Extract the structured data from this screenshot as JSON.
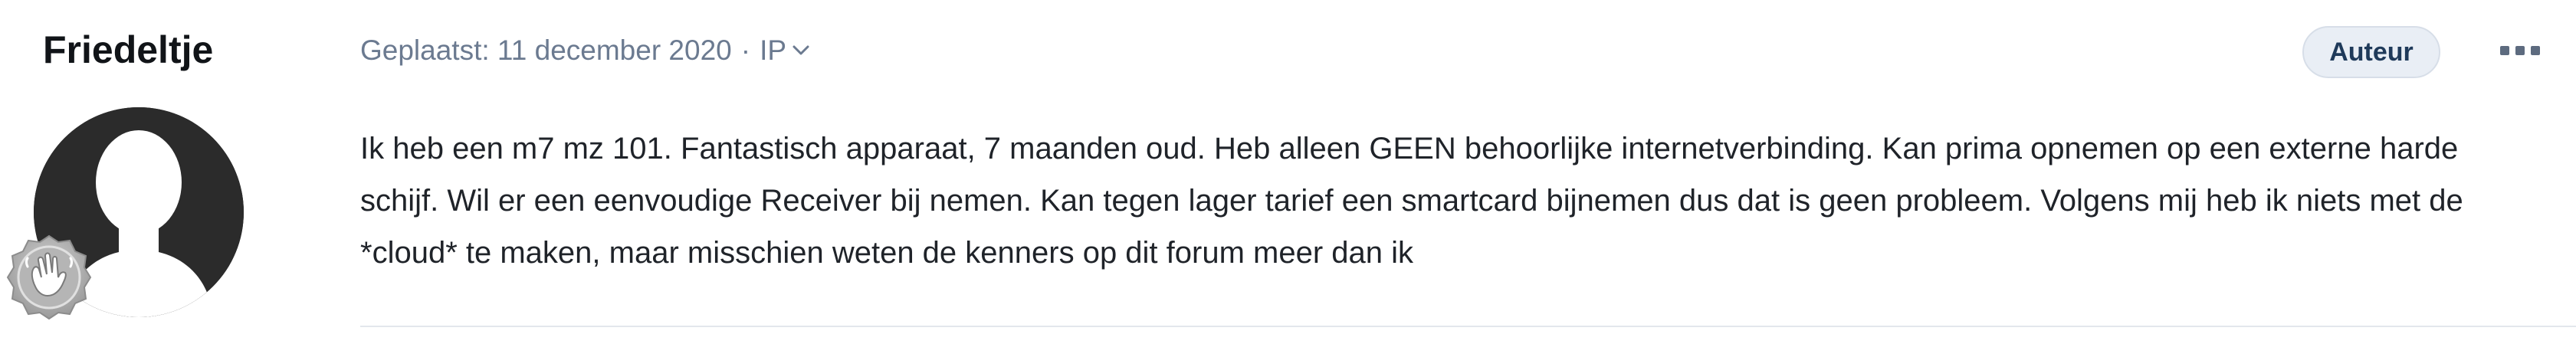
{
  "post": {
    "author": {
      "name": "Friedeltje",
      "avatar_icon": "silhouette-avatar",
      "rank_icon": "waving-hand-badge"
    },
    "meta": {
      "posted_label": "Geplaatst: 11 december 2020",
      "separator": "·",
      "ip_label": "IP"
    },
    "author_badge": "Auteur",
    "body_lines": [
      "Ik heb een m7 mz 101. Fantastisch apparaat, 7 maanden oud. Heb alleen GEEN behoorlijke internetverbinding. Kan prima opnemen op een externe harde",
      "schijf. Wil er een eenvoudige Receiver bij nemen. Kan tegen lager tarief een smartcard bijnemen dus dat is geen probleem. Volgens mij heb ik niets met de",
      "*cloud* te maken, maar misschien weten de kenners op dit forum meer dan ik"
    ]
  },
  "colors": {
    "meta_text": "#6b7a90",
    "badge_bg": "#e9eef5",
    "avatar_bg": "#2a2a2a"
  }
}
